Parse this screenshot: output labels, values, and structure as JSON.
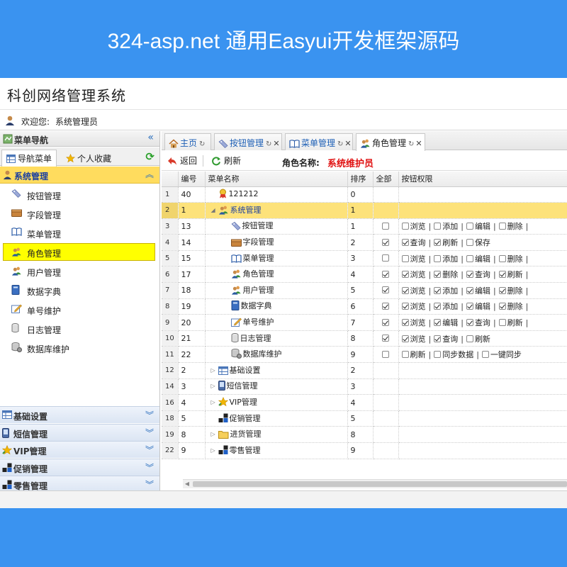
{
  "banner": {
    "title": "324-asp.net 通用Easyui开发框架源码"
  },
  "app": {
    "title": "科创网络管理系统",
    "welcome_label": "欢迎您:",
    "user_name": "系统管理员"
  },
  "west": {
    "header": "菜单导航",
    "tabs": [
      "导航菜单",
      "个人收藏"
    ],
    "active_group": "系统管理",
    "items": [
      {
        "label": "按钮管理",
        "icon": "tag-icon"
      },
      {
        "label": "字段管理",
        "icon": "box-icon"
      },
      {
        "label": "菜单管理",
        "icon": "book-icon"
      },
      {
        "label": "角色管理",
        "icon": "users-icon",
        "selected": true
      },
      {
        "label": "用户管理",
        "icon": "users-icon"
      },
      {
        "label": "数据字典",
        "icon": "dictionary-icon"
      },
      {
        "label": "单号维护",
        "icon": "edit-icon"
      },
      {
        "label": "日志管理",
        "icon": "cylinder-icon"
      },
      {
        "label": "数据库维护",
        "icon": "database-icon"
      }
    ],
    "groups": [
      "基础设置",
      "短信管理",
      "VIP管理",
      "促销管理",
      "零售管理"
    ]
  },
  "tabs": {
    "home": "主页",
    "items": [
      "按钮管理",
      "菜单管理",
      "角色管理"
    ],
    "active": "角色管理"
  },
  "toolbar": {
    "back": "返回",
    "refresh": "刷新",
    "role_label": "角色名称:",
    "role_value": "系统维护员"
  },
  "grid": {
    "columns": [
      "编号",
      "菜单名称",
      "排序",
      "全部",
      "按钮权限"
    ],
    "rows": [
      {
        "rn": "1",
        "id": "40",
        "name": "121212",
        "sort": "0",
        "level": 0,
        "icon": "badge-icon",
        "toggle": "",
        "all": null,
        "perms": []
      },
      {
        "rn": "2",
        "id": "1",
        "name": "系统管理",
        "sort": "1",
        "level": 0,
        "icon": "users-icon",
        "toggle": "open",
        "all": null,
        "perms": [],
        "selected": true
      },
      {
        "rn": "3",
        "id": "13",
        "name": "按钮管理",
        "sort": "1",
        "level": 1,
        "icon": "tag-icon",
        "all": false,
        "perms": [
          [
            "浏览",
            false
          ],
          [
            "添加",
            false
          ],
          [
            "编辑",
            false
          ],
          [
            "删除",
            false
          ]
        ]
      },
      {
        "rn": "4",
        "id": "14",
        "name": "字段管理",
        "sort": "2",
        "level": 1,
        "icon": "box-icon",
        "all": true,
        "perms": [
          [
            "查询",
            true
          ],
          [
            "刷新",
            true
          ],
          [
            "保存",
            false
          ]
        ]
      },
      {
        "rn": "5",
        "id": "15",
        "name": "菜单管理",
        "sort": "3",
        "level": 1,
        "icon": "book-icon",
        "all": false,
        "perms": [
          [
            "浏览",
            false
          ],
          [
            "添加",
            false
          ],
          [
            "编辑",
            false
          ],
          [
            "删除",
            false
          ]
        ]
      },
      {
        "rn": "6",
        "id": "17",
        "name": "角色管理",
        "sort": "4",
        "level": 1,
        "icon": "users-icon",
        "all": true,
        "perms": [
          [
            "浏览",
            true
          ],
          [
            "删除",
            true
          ],
          [
            "查询",
            true
          ],
          [
            "刷新",
            true
          ]
        ]
      },
      {
        "rn": "7",
        "id": "18",
        "name": "用户管理",
        "sort": "5",
        "level": 1,
        "icon": "users-icon",
        "all": true,
        "perms": [
          [
            "浏览",
            true
          ],
          [
            "添加",
            true
          ],
          [
            "编辑",
            true
          ],
          [
            "删除",
            true
          ]
        ]
      },
      {
        "rn": "8",
        "id": "19",
        "name": "数据字典",
        "sort": "6",
        "level": 1,
        "icon": "dictionary-icon",
        "all": true,
        "perms": [
          [
            "浏览",
            true
          ],
          [
            "添加",
            true
          ],
          [
            "编辑",
            true
          ],
          [
            "删除",
            true
          ]
        ]
      },
      {
        "rn": "9",
        "id": "20",
        "name": "单号维护",
        "sort": "7",
        "level": 1,
        "icon": "edit-icon",
        "all": true,
        "perms": [
          [
            "浏览",
            true
          ],
          [
            "编辑",
            true
          ],
          [
            "查询",
            true
          ],
          [
            "刷新",
            false
          ]
        ]
      },
      {
        "rn": "10",
        "id": "21",
        "name": "日志管理",
        "sort": "8",
        "level": 1,
        "icon": "cylinder-icon",
        "all": true,
        "perms": [
          [
            "浏览",
            true
          ],
          [
            "查询",
            true
          ],
          [
            "刷新",
            false
          ]
        ]
      },
      {
        "rn": "11",
        "id": "22",
        "name": "数据库维护",
        "sort": "9",
        "level": 1,
        "icon": "database-icon",
        "all": false,
        "perms": [
          [
            "刷新",
            false
          ],
          [
            "同步数据",
            false
          ],
          [
            "一键同步",
            false
          ]
        ]
      },
      {
        "rn": "12",
        "id": "2",
        "name": "基础设置",
        "sort": "2",
        "level": 0,
        "icon": "grid-icon",
        "toggle": "closed",
        "all": null,
        "perms": []
      },
      {
        "rn": "14",
        "id": "3",
        "name": "短信管理",
        "sort": "3",
        "level": 0,
        "icon": "phone-icon",
        "toggle": "closed",
        "all": null,
        "perms": []
      },
      {
        "rn": "16",
        "id": "4",
        "name": "VIP管理",
        "sort": "4",
        "level": 0,
        "icon": "star-icon",
        "toggle": "closed",
        "all": null,
        "perms": []
      },
      {
        "rn": "18",
        "id": "5",
        "name": "促销管理",
        "sort": "5",
        "level": 0,
        "icon": "blocks-icon",
        "toggle": "",
        "all": null,
        "perms": []
      },
      {
        "rn": "19",
        "id": "8",
        "name": "进货管理",
        "sort": "8",
        "level": 0,
        "icon": "folder-icon",
        "toggle": "closed",
        "all": null,
        "perms": []
      },
      {
        "rn": "22",
        "id": "9",
        "name": "零售管理",
        "sort": "9",
        "level": 0,
        "icon": "blocks-icon",
        "toggle": "closed",
        "all": null,
        "perms": []
      }
    ]
  },
  "colors": {
    "banner": "#3a93f0",
    "selected_row": "#fde27a",
    "selected_nav": "#ffff00",
    "role_value": "#e01010"
  }
}
